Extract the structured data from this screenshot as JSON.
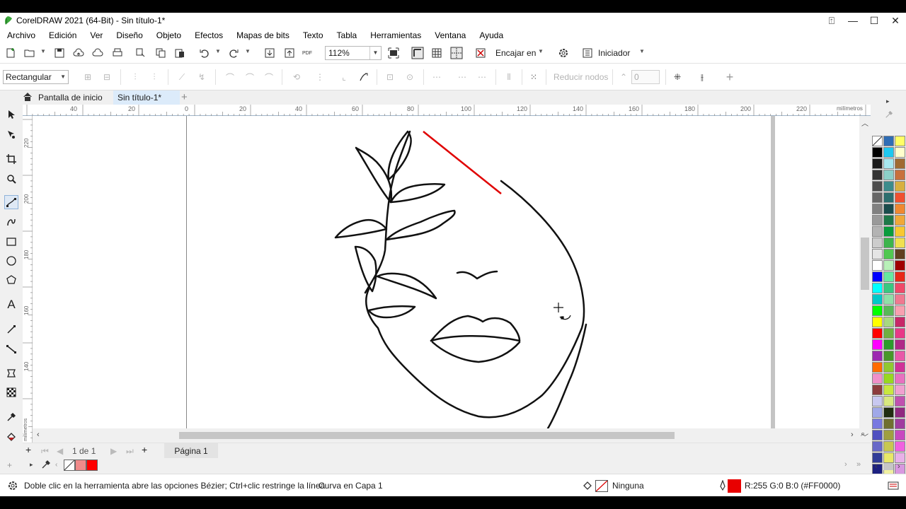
{
  "window": {
    "title": "CorelDRAW 2021 (64-Bit) - Sin título-1*",
    "controls": [
      "⍐",
      "—",
      "☐",
      "✕"
    ]
  },
  "menu": [
    "Archivo",
    "Edición",
    "Ver",
    "Diseño",
    "Objeto",
    "Efectos",
    "Mapas de bits",
    "Texto",
    "Tabla",
    "Herramientas",
    "Ventana",
    "Ayuda"
  ],
  "toolbar": {
    "zoom_value": "112%",
    "snap_label": "Encajar en",
    "launcher_label": "Iniciador",
    "pdf_label": "PDF"
  },
  "propbar": {
    "mode": "Rectangular",
    "reduce_nodes": "Reducir nodos",
    "node_value": "0"
  },
  "tabs": {
    "home": "Pantalla de inicio",
    "document": "Sin título-1*",
    "add": "+"
  },
  "ruler": {
    "h_labels": [
      "40",
      "20",
      "0",
      "20",
      "40",
      "60",
      "80",
      "100",
      "120",
      "140",
      "160",
      "180",
      "200",
      "220"
    ],
    "unit": "milímetros",
    "v_labels": [
      "220",
      "200",
      "180",
      "160",
      "140"
    ],
    "v_unit": "milímetros"
  },
  "pagenav": {
    "counter": "1 de 1",
    "page_tab": "Página 1"
  },
  "status": {
    "hint": "Doble clic en la herramienta abre las opciones Bézier; Ctrl+clic restringe la línea",
    "object": "Curva en Capa 1",
    "fill": "Ninguna",
    "outline": "R:255 G:0 B:0 (#FF0000)"
  },
  "colors": {
    "accent": "#ff0000",
    "outline_swatch": "#e80000",
    "doc_swatch_pink": "#f08a8a",
    "doc_swatch_red": "#ff0000"
  },
  "palette": [
    [
      "none",
      "#2f6db5",
      "#ffff66"
    ],
    [
      "#000000",
      "#1ec8f0",
      "#ffffcc"
    ],
    [
      "#1a1a1a",
      "#a8e8f0",
      "#a06a30"
    ],
    [
      "#333333",
      "#8ccfc8",
      "#c8703c"
    ],
    [
      "#4d4d4d",
      "#3c8c8c",
      "#d8b040"
    ],
    [
      "#666666",
      "#2c6e6e",
      "#f05030"
    ],
    [
      "#808080",
      "#1a4c4c",
      "#f08830"
    ],
    [
      "#999999",
      "#1e7848",
      "#f0a838"
    ],
    [
      "#b3b3b3",
      "#0a9c3c",
      "#f8c830"
    ],
    [
      "#cccccc",
      "#3cb44c",
      "#f0e050"
    ],
    [
      "#e5e5e5",
      "#50c850",
      "#604020"
    ],
    [
      "#ffffff",
      "#b8f0b8",
      "#a00000"
    ],
    [
      "#0000ff",
      "#66e8a0",
      "#e82818"
    ],
    [
      "#00ffff",
      "#38c880",
      "#f04868"
    ],
    [
      "#00c8c8",
      "#90e0a8",
      "#f07890"
    ],
    [
      "#00ff00",
      "#58b858",
      "#f8a0b0"
    ],
    [
      "#ffff00",
      "#a8d880",
      "#c82868"
    ],
    [
      "#ff0000",
      "#70b040",
      "#e83888"
    ],
    [
      "#ff00ff",
      "#2c9c2c",
      "#b02888"
    ],
    [
      "#9c28b0",
      "#489828",
      "#e858a8"
    ],
    [
      "#ff6c00",
      "#90c830",
      "#d03098"
    ],
    [
      "#f090c8",
      "#98d820",
      "#e870c0"
    ],
    [
      "#8c3c3c",
      "#c8e840",
      "#f0a0d0"
    ],
    [
      "#c8c8f0",
      "#d8e880",
      "#c050b0"
    ],
    [
      "#a0a8e8",
      "#202c10",
      "#902880"
    ],
    [
      "#7878e0",
      "#707030",
      "#a03ca0"
    ],
    [
      "#5050c0",
      "#a0a040",
      "#c848c0"
    ],
    [
      "#6868c8",
      "#c8c850",
      "#f060e0"
    ],
    [
      "#303c98",
      "#e8e868",
      "#e8b0e8"
    ],
    [
      "#1c2080",
      "#f0f0a0",
      "#d898e0"
    ],
    [
      "#001060",
      "#e8e830",
      "#b070c8"
    ]
  ]
}
